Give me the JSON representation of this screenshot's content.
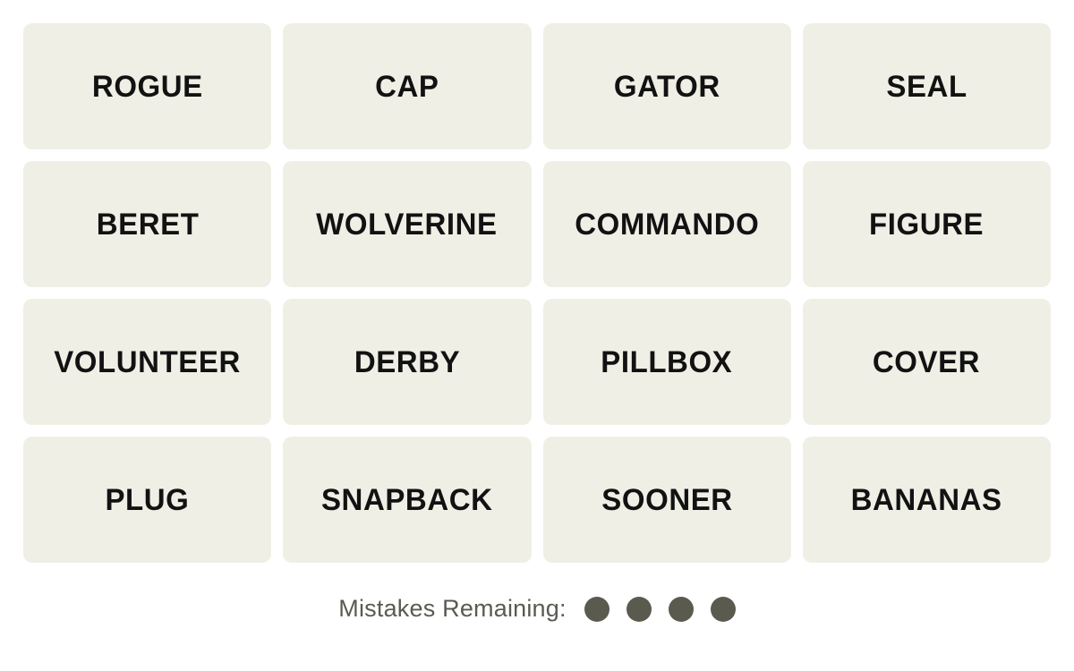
{
  "board": {
    "rows": 4,
    "columns": 4,
    "tile_color": "#EFEFE6",
    "tile_text_color": "#121212",
    "background_color": "#FFFFFF",
    "tiles": [
      {
        "label": "ROGUE"
      },
      {
        "label": "CAP"
      },
      {
        "label": "GATOR"
      },
      {
        "label": "SEAL"
      },
      {
        "label": "BERET"
      },
      {
        "label": "WOLVERINE"
      },
      {
        "label": "COMMANDO"
      },
      {
        "label": "FIGURE"
      },
      {
        "label": "VOLUNTEER"
      },
      {
        "label": "DERBY"
      },
      {
        "label": "PILLBOX"
      },
      {
        "label": "COVER"
      },
      {
        "label": "PLUG"
      },
      {
        "label": "SNAPBACK"
      },
      {
        "label": "SOONER"
      },
      {
        "label": "BANANAS"
      }
    ]
  },
  "footer": {
    "mistakes_label": "Mistakes Remaining:",
    "mistakes_remaining": 4,
    "dot_color": "#5A5A4F",
    "label_color": "#5A5A52",
    "dots": [
      {
        "state": "remaining"
      },
      {
        "state": "remaining"
      },
      {
        "state": "remaining"
      },
      {
        "state": "remaining"
      }
    ]
  }
}
